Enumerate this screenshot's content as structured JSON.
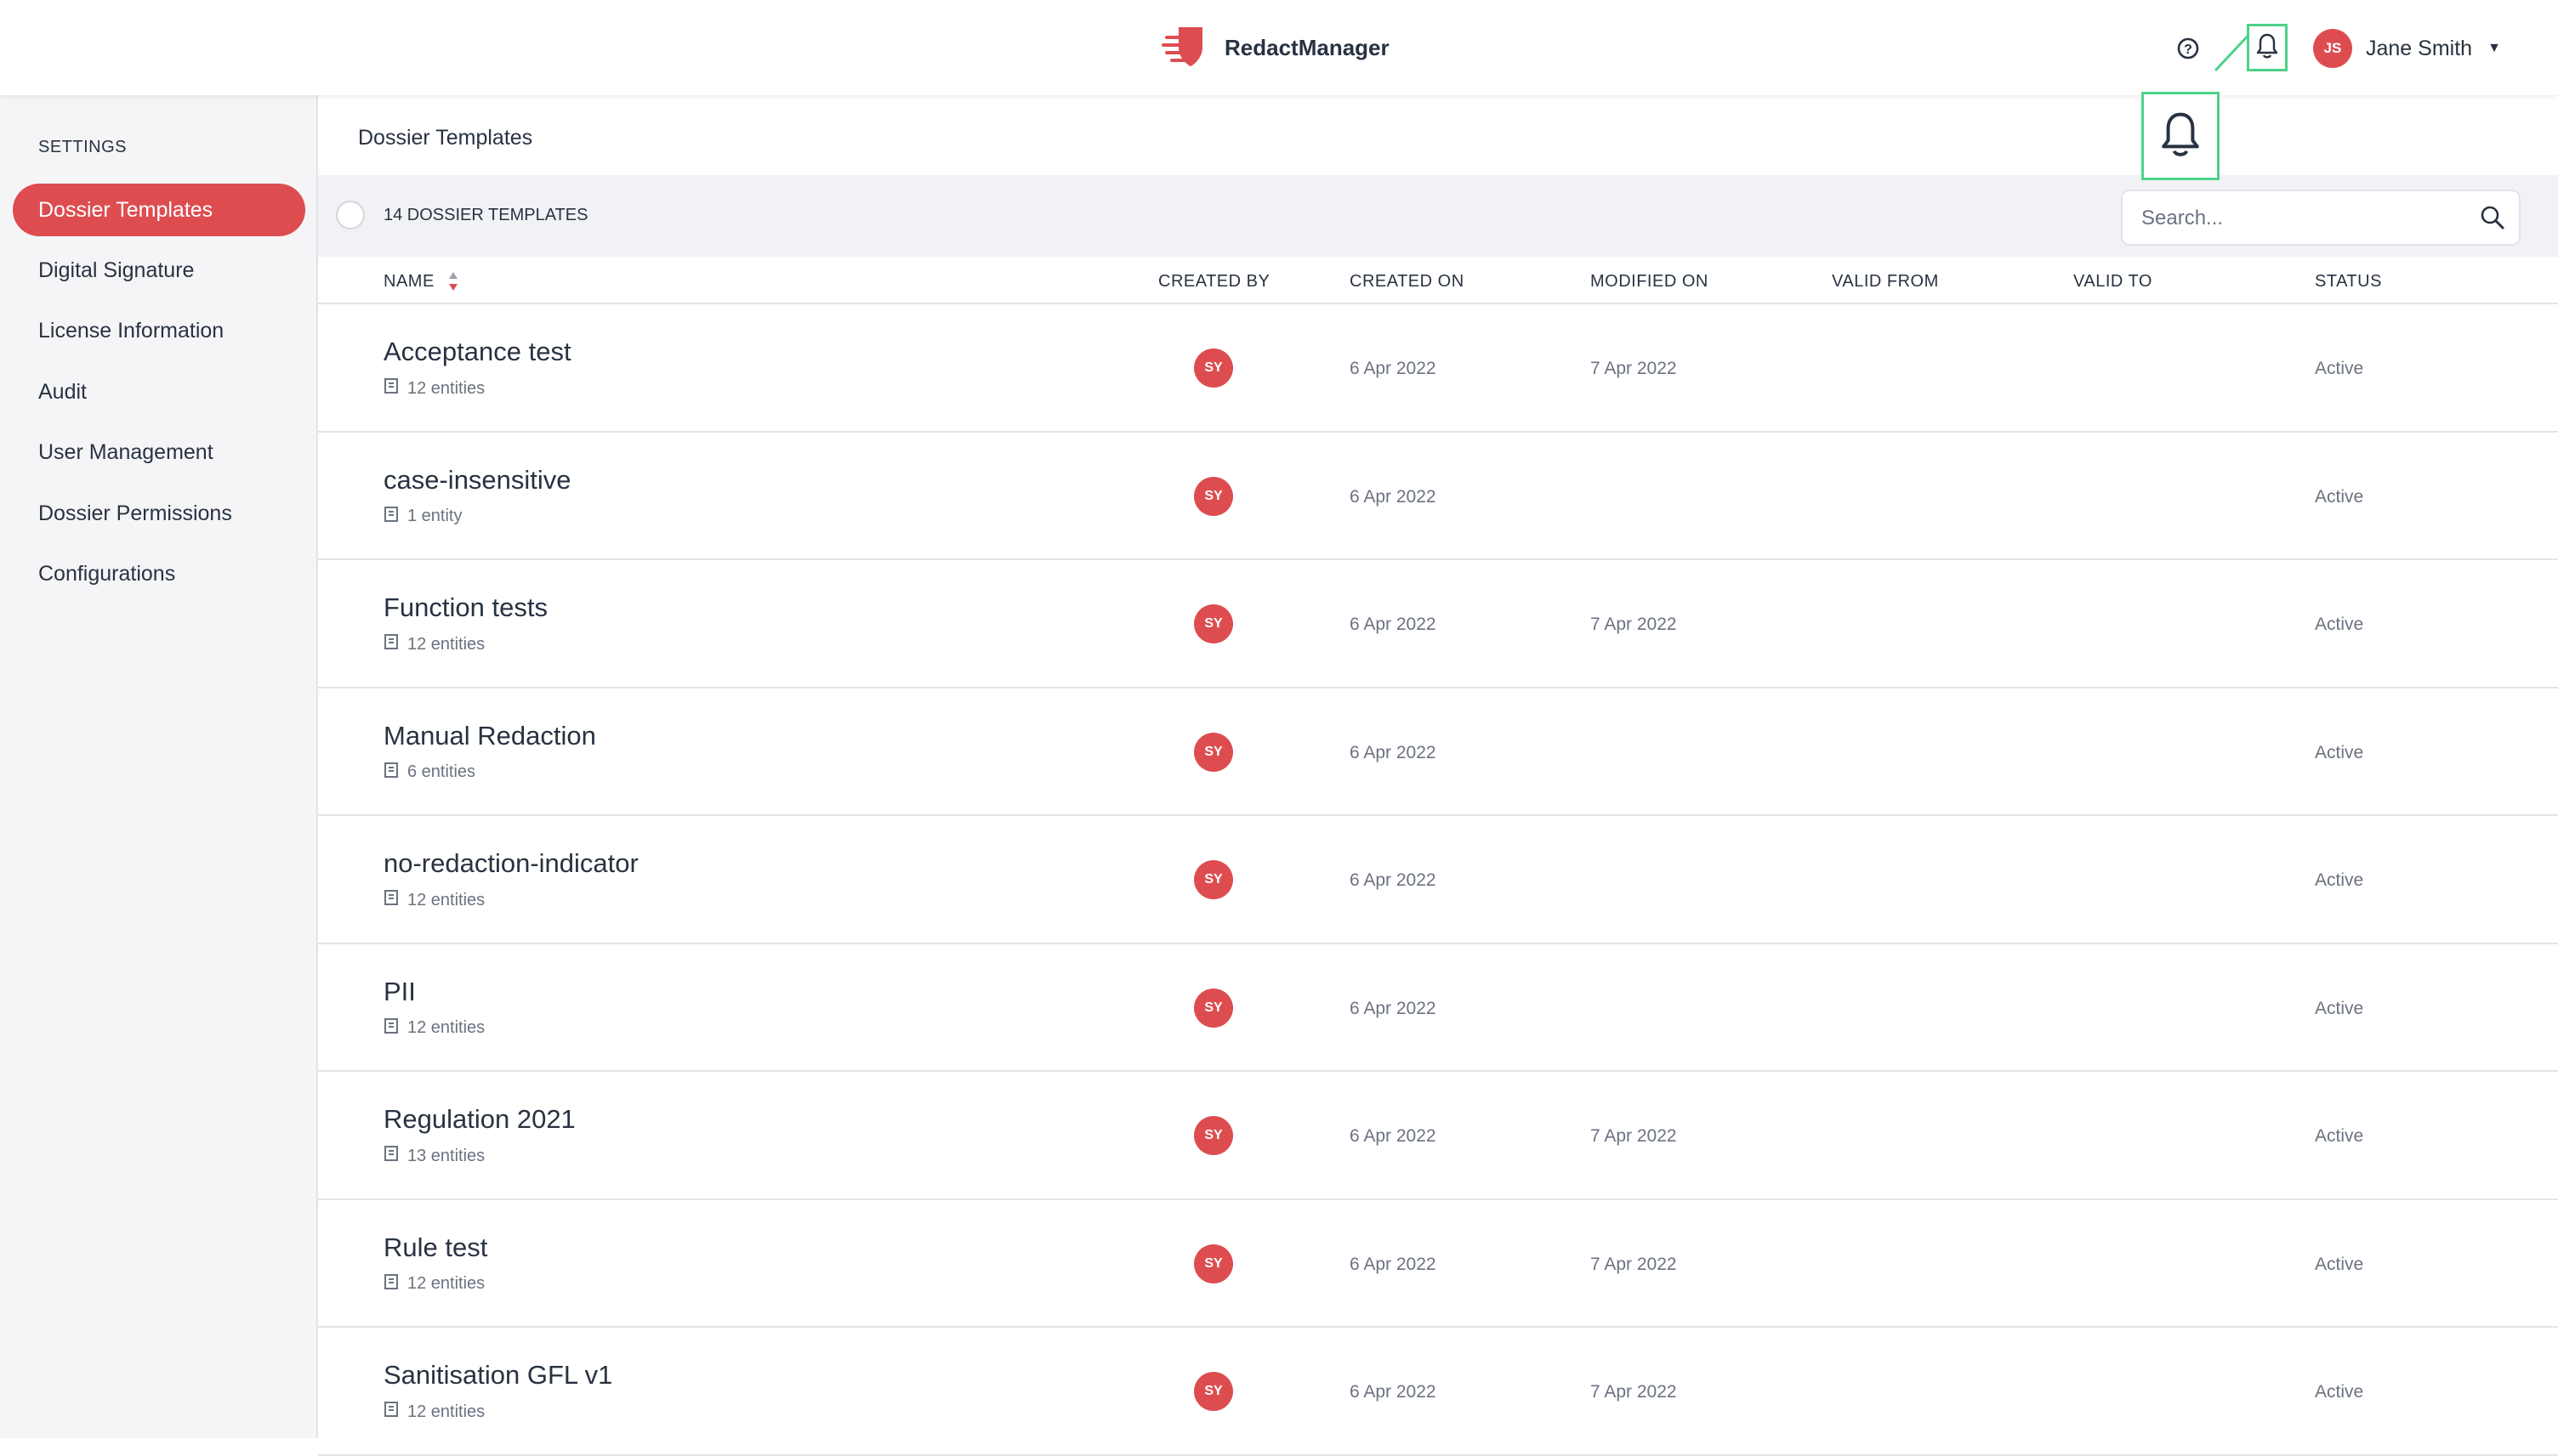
{
  "app": {
    "name": "RedactManager",
    "brand_color": "#dd4d50"
  },
  "header": {
    "help_icon": "help-circle-icon",
    "notifications_icon": "bell-icon",
    "user": {
      "initials": "JS",
      "name": "Jane Smith"
    }
  },
  "sidebar": {
    "section_label": "SETTINGS",
    "items": [
      {
        "label": "Dossier Templates",
        "active": true
      },
      {
        "label": "Digital Signature",
        "active": false
      },
      {
        "label": "License Information",
        "active": false
      },
      {
        "label": "Audit",
        "active": false
      },
      {
        "label": "User Management",
        "active": false
      },
      {
        "label": "Dossier Permissions",
        "active": false
      },
      {
        "label": "Configurations",
        "active": false
      }
    ]
  },
  "main": {
    "title": "Dossier Templates",
    "count_label": "14 DOSSIER TEMPLATES",
    "search": {
      "placeholder": "Search...",
      "value": ""
    },
    "columns": [
      "NAME",
      "CREATED BY",
      "CREATED ON",
      "MODIFIED ON",
      "VALID FROM",
      "VALID TO",
      "STATUS"
    ],
    "rows": [
      {
        "name": "Acceptance test",
        "entities": "12 entities",
        "created_by": "SY",
        "created_on": "6 Apr 2022",
        "modified_on": "7 Apr 2022",
        "valid_from": "",
        "valid_to": "",
        "status": "Active"
      },
      {
        "name": "case-insensitive",
        "entities": "1 entity",
        "created_by": "SY",
        "created_on": "6 Apr 2022",
        "modified_on": "",
        "valid_from": "",
        "valid_to": "",
        "status": "Active"
      },
      {
        "name": "Function tests",
        "entities": "12 entities",
        "created_by": "SY",
        "created_on": "6 Apr 2022",
        "modified_on": "7 Apr 2022",
        "valid_from": "",
        "valid_to": "",
        "status": "Active"
      },
      {
        "name": "Manual Redaction",
        "entities": "6 entities",
        "created_by": "SY",
        "created_on": "6 Apr 2022",
        "modified_on": "",
        "valid_from": "",
        "valid_to": "",
        "status": "Active"
      },
      {
        "name": "no-redaction-indicator",
        "entities": "12 entities",
        "created_by": "SY",
        "created_on": "6 Apr 2022",
        "modified_on": "",
        "valid_from": "",
        "valid_to": "",
        "status": "Active"
      },
      {
        "name": "PII",
        "entities": "12 entities",
        "created_by": "SY",
        "created_on": "6 Apr 2022",
        "modified_on": "",
        "valid_from": "",
        "valid_to": "",
        "status": "Active"
      },
      {
        "name": "Regulation 2021",
        "entities": "13 entities",
        "created_by": "SY",
        "created_on": "6 Apr 2022",
        "modified_on": "7 Apr 2022",
        "valid_from": "",
        "valid_to": "",
        "status": "Active"
      },
      {
        "name": "Rule test",
        "entities": "12 entities",
        "created_by": "SY",
        "created_on": "6 Apr 2022",
        "modified_on": "7 Apr 2022",
        "valid_from": "",
        "valid_to": "",
        "status": "Active"
      },
      {
        "name": "Sanitisation GFL v1",
        "entities": "12 entities",
        "created_by": "SY",
        "created_on": "6 Apr 2022",
        "modified_on": "7 Apr 2022",
        "valid_from": "",
        "valid_to": "",
        "status": "Active"
      }
    ]
  }
}
